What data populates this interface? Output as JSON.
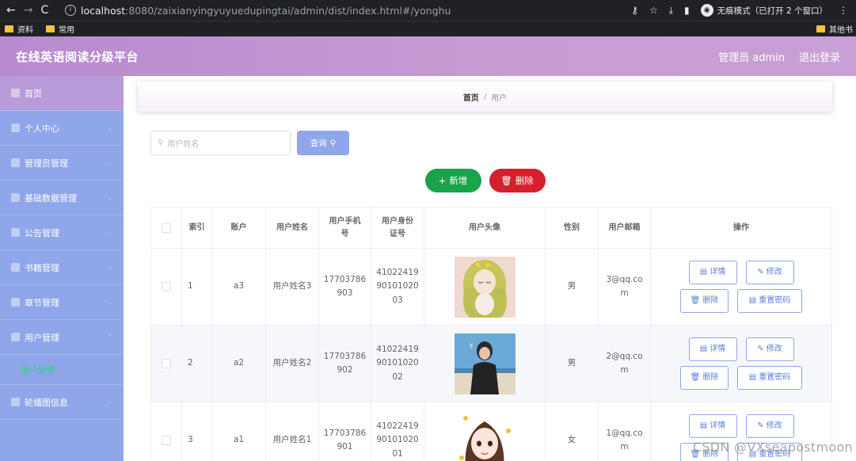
{
  "browser": {
    "url_host": "localhost",
    "url_rest": ":8080/zaixianyingyuyuedupingtai/admin/dist/index.html#/yonghu",
    "incognito_label": "无痕模式（已打开 2 个窗口）",
    "bookmarks": [
      "资料",
      "常用"
    ],
    "bookmarks_right": "其他书"
  },
  "header": {
    "title": "在线英语阅读分级平台",
    "user_label": "管理员 admin",
    "logout_label": "退出登录"
  },
  "sidebar": {
    "items": [
      {
        "label": "首页"
      },
      {
        "label": "个人中心"
      },
      {
        "label": "管理员管理"
      },
      {
        "label": "基础数据管理"
      },
      {
        "label": "公告管理"
      },
      {
        "label": "书籍管理"
      },
      {
        "label": "章节管理"
      },
      {
        "label": "用户管理"
      },
      {
        "label": "轮播图信息"
      }
    ],
    "sub_item": "用户管理"
  },
  "breadcrumb": {
    "home": "首页",
    "separator": "/",
    "current": "用户"
  },
  "search": {
    "placeholder": "用户姓名",
    "button_label": "查询"
  },
  "actions": {
    "add_label": "新增",
    "delete_label": "删除"
  },
  "table": {
    "headers": {
      "index": "索引",
      "account": "账户",
      "name": "用户姓名",
      "phone": "用户手机号",
      "idcard": "用户身份证号",
      "avatar": "用户头像",
      "gender": "性别",
      "email": "用户邮箱",
      "ops": "操作"
    },
    "rows": [
      {
        "index": "1",
        "account": "a3",
        "name": "用户姓名3",
        "phone": "17703786903",
        "idcard": "410224199010102003",
        "gender": "男",
        "email": "3@qq.com"
      },
      {
        "index": "2",
        "account": "a2",
        "name": "用户姓名2",
        "phone": "17703786902",
        "idcard": "410224199010102002",
        "gender": "男",
        "email": "2@qq.com"
      },
      {
        "index": "3",
        "account": "a1",
        "name": "用户姓名1",
        "phone": "17703786901",
        "idcard": "410224199010102001",
        "gender": "女",
        "email": "1@qq.com"
      }
    ],
    "op_labels": {
      "detail": "详情",
      "edit": "修改",
      "delete": "删除",
      "reset": "重置密码"
    }
  },
  "watermark": "CSDN @VXseapostmoon"
}
